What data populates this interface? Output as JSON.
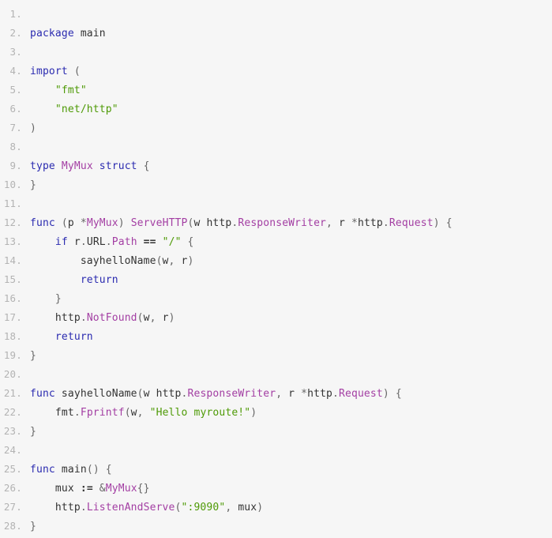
{
  "editor": {
    "language": "go",
    "background_color": "#f6f6f6",
    "line_number_color": "#b3b3b3",
    "total_lines": 28,
    "first_line_number": 1
  },
  "theme": {
    "keyword_color": "#2b2bb0",
    "type_color": "#a33ea3",
    "string_color": "#4e9a06",
    "plain_color": "#333333",
    "punct_color": "#666666"
  },
  "code": {
    "plain_text": "package main\n\nimport (\n    \"fmt\"\n    \"net/http\"\n)\n\ntype MyMux struct {\n}\n\nfunc (p *MyMux) ServeHTTP(w http.ResponseWriter, r *http.Request) {\n    if r.URL.Path == \"/\" {\n        sayhelloName(w, r)\n        return\n    }\n    http.NotFound(w, r)\n    return\n}\n\nfunc sayhelloName(w http.ResponseWriter, r *http.Request) {\n    fmt.Fprintf(w, \"Hello myroute!\")\n}\n\nfunc main() {\n    mux := &MyMux{}\n    http.ListenAndServe(\":9090\", mux)\n}",
    "lines": [
      {
        "number": "1.",
        "text": "",
        "tokens": []
      },
      {
        "number": "2.",
        "text": "package main",
        "tokens": [
          {
            "t": "package",
            "c": "keyword"
          },
          {
            "t": " ",
            "c": "plain"
          },
          {
            "t": "main",
            "c": "ident"
          }
        ]
      },
      {
        "number": "3.",
        "text": "",
        "tokens": []
      },
      {
        "number": "4.",
        "text": "import (",
        "tokens": [
          {
            "t": "import",
            "c": "keyword"
          },
          {
            "t": " ",
            "c": "plain"
          },
          {
            "t": "(",
            "c": "punct"
          }
        ]
      },
      {
        "number": "5.",
        "text": "    \"fmt\"",
        "tokens": [
          {
            "t": "    ",
            "c": "plain"
          },
          {
            "t": "\"fmt\"",
            "c": "string"
          }
        ]
      },
      {
        "number": "6.",
        "text": "    \"net/http\"",
        "tokens": [
          {
            "t": "    ",
            "c": "plain"
          },
          {
            "t": "\"net/http\"",
            "c": "string"
          }
        ]
      },
      {
        "number": "7.",
        "text": ")",
        "tokens": [
          {
            "t": ")",
            "c": "punct"
          }
        ]
      },
      {
        "number": "8.",
        "text": "",
        "tokens": []
      },
      {
        "number": "9.",
        "text": "type MyMux struct {",
        "tokens": [
          {
            "t": "type",
            "c": "keyword"
          },
          {
            "t": " ",
            "c": "plain"
          },
          {
            "t": "MyMux",
            "c": "type"
          },
          {
            "t": " ",
            "c": "plain"
          },
          {
            "t": "struct",
            "c": "keyword"
          },
          {
            "t": " ",
            "c": "plain"
          },
          {
            "t": "{",
            "c": "punct"
          }
        ]
      },
      {
        "number": "10.",
        "text": "}",
        "tokens": [
          {
            "t": "}",
            "c": "punct"
          }
        ]
      },
      {
        "number": "11.",
        "text": "",
        "tokens": []
      },
      {
        "number": "12.",
        "text": "func (p *MyMux) ServeHTTP(w http.ResponseWriter, r *http.Request) {",
        "tokens": [
          {
            "t": "func",
            "c": "keyword"
          },
          {
            "t": " ",
            "c": "plain"
          },
          {
            "t": "(",
            "c": "punct"
          },
          {
            "t": "p",
            "c": "ident"
          },
          {
            "t": " ",
            "c": "plain"
          },
          {
            "t": "*",
            "c": "punct"
          },
          {
            "t": "MyMux",
            "c": "type"
          },
          {
            "t": ")",
            "c": "punct"
          },
          {
            "t": " ",
            "c": "plain"
          },
          {
            "t": "ServeHTTP",
            "c": "type"
          },
          {
            "t": "(",
            "c": "punct"
          },
          {
            "t": "w",
            "c": "ident"
          },
          {
            "t": " ",
            "c": "plain"
          },
          {
            "t": "http",
            "c": "ident"
          },
          {
            "t": ".",
            "c": "punct"
          },
          {
            "t": "ResponseWriter",
            "c": "type"
          },
          {
            "t": ",",
            "c": "punct"
          },
          {
            "t": " ",
            "c": "plain"
          },
          {
            "t": "r",
            "c": "ident"
          },
          {
            "t": " ",
            "c": "plain"
          },
          {
            "t": "*",
            "c": "punct"
          },
          {
            "t": "http",
            "c": "ident"
          },
          {
            "t": ".",
            "c": "punct"
          },
          {
            "t": "Request",
            "c": "type"
          },
          {
            "t": ")",
            "c": "punct"
          },
          {
            "t": " ",
            "c": "plain"
          },
          {
            "t": "{",
            "c": "punct"
          }
        ]
      },
      {
        "number": "13.",
        "text": "    if r.URL.Path == \"/\" {",
        "tokens": [
          {
            "t": "    ",
            "c": "plain"
          },
          {
            "t": "if",
            "c": "keyword"
          },
          {
            "t": " ",
            "c": "plain"
          },
          {
            "t": "r",
            "c": "ident"
          },
          {
            "t": ".",
            "c": "punct"
          },
          {
            "t": "URL",
            "c": "ident"
          },
          {
            "t": ".",
            "c": "punct"
          },
          {
            "t": "Path",
            "c": "type"
          },
          {
            "t": " ",
            "c": "plain"
          },
          {
            "t": "==",
            "c": "operator"
          },
          {
            "t": " ",
            "c": "plain"
          },
          {
            "t": "\"/\"",
            "c": "string"
          },
          {
            "t": " ",
            "c": "plain"
          },
          {
            "t": "{",
            "c": "punct"
          }
        ]
      },
      {
        "number": "14.",
        "text": "        sayhelloName(w, r)",
        "tokens": [
          {
            "t": "        ",
            "c": "plain"
          },
          {
            "t": "sayhelloName",
            "c": "ident"
          },
          {
            "t": "(",
            "c": "punct"
          },
          {
            "t": "w",
            "c": "ident"
          },
          {
            "t": ",",
            "c": "punct"
          },
          {
            "t": " ",
            "c": "plain"
          },
          {
            "t": "r",
            "c": "ident"
          },
          {
            "t": ")",
            "c": "punct"
          }
        ]
      },
      {
        "number": "15.",
        "text": "        return",
        "tokens": [
          {
            "t": "        ",
            "c": "plain"
          },
          {
            "t": "return",
            "c": "keyword"
          }
        ]
      },
      {
        "number": "16.",
        "text": "    }",
        "tokens": [
          {
            "t": "    ",
            "c": "plain"
          },
          {
            "t": "}",
            "c": "punct"
          }
        ]
      },
      {
        "number": "17.",
        "text": "    http.NotFound(w, r)",
        "tokens": [
          {
            "t": "    ",
            "c": "plain"
          },
          {
            "t": "http",
            "c": "ident"
          },
          {
            "t": ".",
            "c": "punct"
          },
          {
            "t": "NotFound",
            "c": "type"
          },
          {
            "t": "(",
            "c": "punct"
          },
          {
            "t": "w",
            "c": "ident"
          },
          {
            "t": ",",
            "c": "punct"
          },
          {
            "t": " ",
            "c": "plain"
          },
          {
            "t": "r",
            "c": "ident"
          },
          {
            "t": ")",
            "c": "punct"
          }
        ]
      },
      {
        "number": "18.",
        "text": "    return",
        "tokens": [
          {
            "t": "    ",
            "c": "plain"
          },
          {
            "t": "return",
            "c": "keyword"
          }
        ]
      },
      {
        "number": "19.",
        "text": "}",
        "tokens": [
          {
            "t": "}",
            "c": "punct"
          }
        ]
      },
      {
        "number": "20.",
        "text": "",
        "tokens": []
      },
      {
        "number": "21.",
        "text": "func sayhelloName(w http.ResponseWriter, r *http.Request) {",
        "tokens": [
          {
            "t": "func",
            "c": "keyword"
          },
          {
            "t": " ",
            "c": "plain"
          },
          {
            "t": "sayhelloName",
            "c": "ident"
          },
          {
            "t": "(",
            "c": "punct"
          },
          {
            "t": "w",
            "c": "ident"
          },
          {
            "t": " ",
            "c": "plain"
          },
          {
            "t": "http",
            "c": "ident"
          },
          {
            "t": ".",
            "c": "punct"
          },
          {
            "t": "ResponseWriter",
            "c": "type"
          },
          {
            "t": ",",
            "c": "punct"
          },
          {
            "t": " ",
            "c": "plain"
          },
          {
            "t": "r",
            "c": "ident"
          },
          {
            "t": " ",
            "c": "plain"
          },
          {
            "t": "*",
            "c": "punct"
          },
          {
            "t": "http",
            "c": "ident"
          },
          {
            "t": ".",
            "c": "punct"
          },
          {
            "t": "Request",
            "c": "type"
          },
          {
            "t": ")",
            "c": "punct"
          },
          {
            "t": " ",
            "c": "plain"
          },
          {
            "t": "{",
            "c": "punct"
          }
        ]
      },
      {
        "number": "22.",
        "text": "    fmt.Fprintf(w, \"Hello myroute!\")",
        "tokens": [
          {
            "t": "    ",
            "c": "plain"
          },
          {
            "t": "fmt",
            "c": "ident"
          },
          {
            "t": ".",
            "c": "punct"
          },
          {
            "t": "Fprintf",
            "c": "type"
          },
          {
            "t": "(",
            "c": "punct"
          },
          {
            "t": "w",
            "c": "ident"
          },
          {
            "t": ",",
            "c": "punct"
          },
          {
            "t": " ",
            "c": "plain"
          },
          {
            "t": "\"Hello myroute!\"",
            "c": "string"
          },
          {
            "t": ")",
            "c": "punct"
          }
        ]
      },
      {
        "number": "23.",
        "text": "}",
        "tokens": [
          {
            "t": "}",
            "c": "punct"
          }
        ]
      },
      {
        "number": "24.",
        "text": "",
        "tokens": []
      },
      {
        "number": "25.",
        "text": "func main() {",
        "tokens": [
          {
            "t": "func",
            "c": "keyword"
          },
          {
            "t": " ",
            "c": "plain"
          },
          {
            "t": "main",
            "c": "ident"
          },
          {
            "t": "(",
            "c": "punct"
          },
          {
            "t": ")",
            "c": "punct"
          },
          {
            "t": " ",
            "c": "plain"
          },
          {
            "t": "{",
            "c": "punct"
          }
        ]
      },
      {
        "number": "26.",
        "text": "    mux := &MyMux{}",
        "tokens": [
          {
            "t": "    ",
            "c": "plain"
          },
          {
            "t": "mux",
            "c": "ident"
          },
          {
            "t": " ",
            "c": "plain"
          },
          {
            "t": ":=",
            "c": "operator"
          },
          {
            "t": " ",
            "c": "plain"
          },
          {
            "t": "&",
            "c": "punct"
          },
          {
            "t": "MyMux",
            "c": "type"
          },
          {
            "t": "{",
            "c": "punct"
          },
          {
            "t": "}",
            "c": "punct"
          }
        ]
      },
      {
        "number": "27.",
        "text": "    http.ListenAndServe(\":9090\", mux)",
        "tokens": [
          {
            "t": "    ",
            "c": "plain"
          },
          {
            "t": "http",
            "c": "ident"
          },
          {
            "t": ".",
            "c": "punct"
          },
          {
            "t": "ListenAndServe",
            "c": "type"
          },
          {
            "t": "(",
            "c": "punct"
          },
          {
            "t": "\":9090\"",
            "c": "string"
          },
          {
            "t": ",",
            "c": "punct"
          },
          {
            "t": " ",
            "c": "plain"
          },
          {
            "t": "mux",
            "c": "ident"
          },
          {
            "t": ")",
            "c": "punct"
          }
        ]
      },
      {
        "number": "28.",
        "text": "}",
        "tokens": [
          {
            "t": "}",
            "c": "punct"
          }
        ]
      }
    ]
  }
}
